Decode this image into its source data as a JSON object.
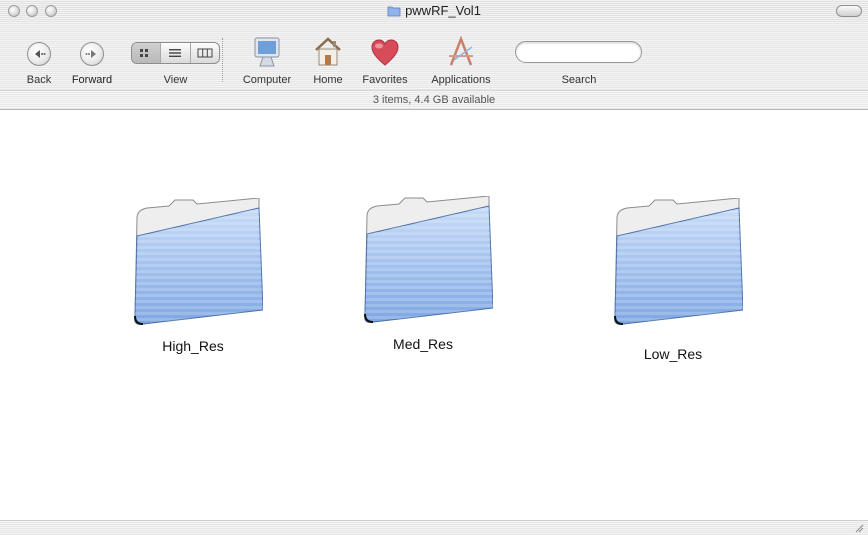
{
  "window": {
    "title": "pwwRF_Vol1"
  },
  "toolbar": {
    "back_label": "Back",
    "forward_label": "Forward",
    "view_label": "View",
    "computer_label": "Computer",
    "home_label": "Home",
    "favorites_label": "Favorites",
    "applications_label": "Applications",
    "search_label": "Search",
    "search_value": ""
  },
  "status": {
    "text": "3 items, 4.4 GB available"
  },
  "folders": [
    {
      "name": "High_Res"
    },
    {
      "name": "Med_Res"
    },
    {
      "name": "Low_Res"
    }
  ],
  "colors": {
    "folder_blue": "#8fb4ea",
    "favorites_red": "#d84c5a"
  },
  "icons": [
    "back-icon",
    "forward-icon",
    "icon-view-icon",
    "list-view-icon",
    "column-view-icon",
    "computer-icon",
    "home-icon",
    "favorites-heart-icon",
    "applications-icon",
    "folder-icon",
    "resize-grip-icon"
  ]
}
